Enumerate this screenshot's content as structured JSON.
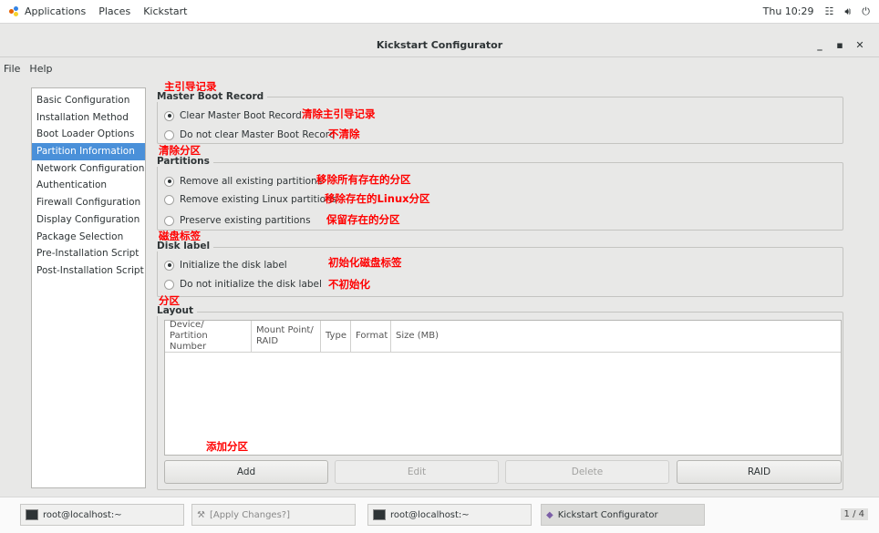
{
  "topbar": {
    "applications": "Applications",
    "places": "Places",
    "kickstart": "Kickstart",
    "time": "Thu 10:29"
  },
  "window": {
    "title": "Kickstart Configurator"
  },
  "menu": {
    "file": "File",
    "help": "Help"
  },
  "sidebar": {
    "items": [
      "Basic Configuration",
      "Installation Method",
      "Boot Loader Options",
      "Partition Information",
      "Network Configuration",
      "Authentication",
      "Firewall Configuration",
      "Display Configuration",
      "Package Selection",
      "Pre-Installation Script",
      "Post-Installation Script"
    ],
    "selected": "Partition Information"
  },
  "mbr": {
    "title": "Master Boot Record",
    "clear": "Clear Master Boot Record",
    "noclear": "Do not clear Master Boot Record"
  },
  "partitions": {
    "title": "Partitions",
    "remove_all": "Remove all existing partitions",
    "remove_linux": "Remove existing Linux partitions",
    "preserve": "Preserve existing partitions"
  },
  "disklabel": {
    "title": "Disk label",
    "init": "Initialize the disk label",
    "noinit": "Do not initialize the disk label"
  },
  "layout": {
    "title": "Layout",
    "columns": [
      "Device/\nPartition Number",
      "Mount Point/\nRAID",
      "Type",
      "Format",
      "Size (MB)"
    ],
    "col1a": "Device/",
    "col1b": "Partition Number",
    "col2a": "Mount Point/",
    "col2b": "RAID",
    "col3": "Type",
    "col4": "Format",
    "col5": "Size (MB)"
  },
  "buttons": {
    "add": "Add",
    "edit": "Edit",
    "delete": "Delete",
    "raid": "RAID"
  },
  "annotations": {
    "mbr": "主引导记录",
    "clear": "清除主引导记录",
    "noclear": "不清除",
    "partitions": "清除分区",
    "remove_all": "移除所有存在的分区",
    "remove_linux": "移除存在的Linux分区",
    "preserve": "保留存在的分区",
    "disklabel": "磁盘标签",
    "init": "初始化磁盘标签",
    "noinit": "不初始化",
    "layout": "分区",
    "add": "添加分区"
  },
  "taskbar": {
    "t1": "root@localhost:~",
    "t2": "[Apply Changes?]",
    "t3": "root@localhost:~",
    "t4": "Kickstart Configurator",
    "pager": "1 / 4"
  },
  "colors": {
    "selection": "#4a90d9",
    "annotation": "#ff0000"
  }
}
